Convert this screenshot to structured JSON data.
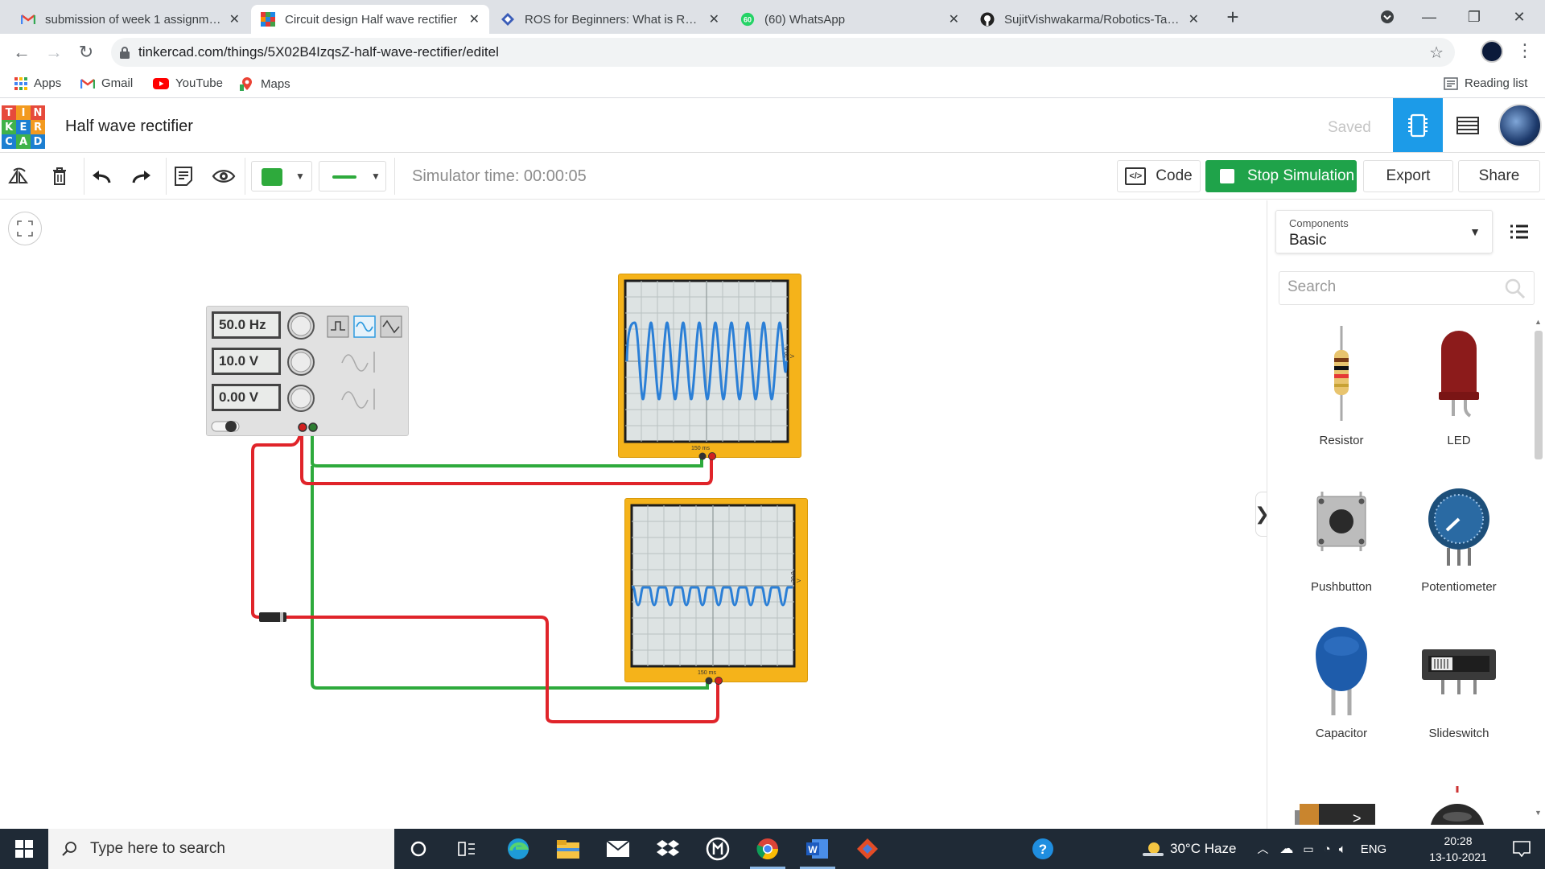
{
  "browser": {
    "tabs": [
      {
        "title": "submission of week 1 assignment",
        "favicon": "gmail-icon"
      },
      {
        "title": "Circuit design Half wave rectifier",
        "favicon": "tinkercad-icon"
      },
      {
        "title": "ROS for Beginners: What is ROS?",
        "favicon": "ros-icon"
      },
      {
        "title": "(60) WhatsApp",
        "favicon": "whatsapp-icon",
        "badge": "60"
      },
      {
        "title": "SujitVishwakarma/Robotics-Tasks",
        "favicon": "github-icon"
      }
    ],
    "url": "tinkercad.com/things/5X02B4IzqsZ-half-wave-rectifier/editel",
    "bookmarks": [
      "Apps",
      "Gmail",
      "YouTube",
      "Maps"
    ],
    "reading_list": "Reading list"
  },
  "tinkercad": {
    "logo_letters": [
      "T",
      "I",
      "N",
      "K",
      "E",
      "R",
      "C",
      "A",
      "D"
    ],
    "design_title": "Half wave rectifier",
    "saved": "Saved"
  },
  "toolbar": {
    "simulator_time": "Simulator time: 00:00:05",
    "code": "Code",
    "stop_simulation": "Stop Simulation",
    "export": "Export",
    "share": "Share",
    "wire_color": "#2eaa3c"
  },
  "function_generator": {
    "frequency": "50.0 Hz",
    "amplitude": "10.0 V",
    "dc_offset": "0.00 V"
  },
  "oscilloscope_top": {
    "time_per_div": "150 ms",
    "voltage_label": "20.0 V"
  },
  "oscilloscope_bottom": {
    "time_per_div": "150 ms",
    "voltage_label": "20.0 V"
  },
  "components_panel": {
    "caption": "Components",
    "selected": "Basic",
    "search_placeholder": "Search",
    "items": [
      "Resistor",
      "LED",
      "Pushbutton",
      "Potentiometer",
      "Capacitor",
      "Slideswitch"
    ]
  },
  "taskbar": {
    "search_placeholder": "Type here to search",
    "weather": "30°C  Haze",
    "language": "ENG",
    "time": "20:28",
    "date": "13-10-2021"
  }
}
